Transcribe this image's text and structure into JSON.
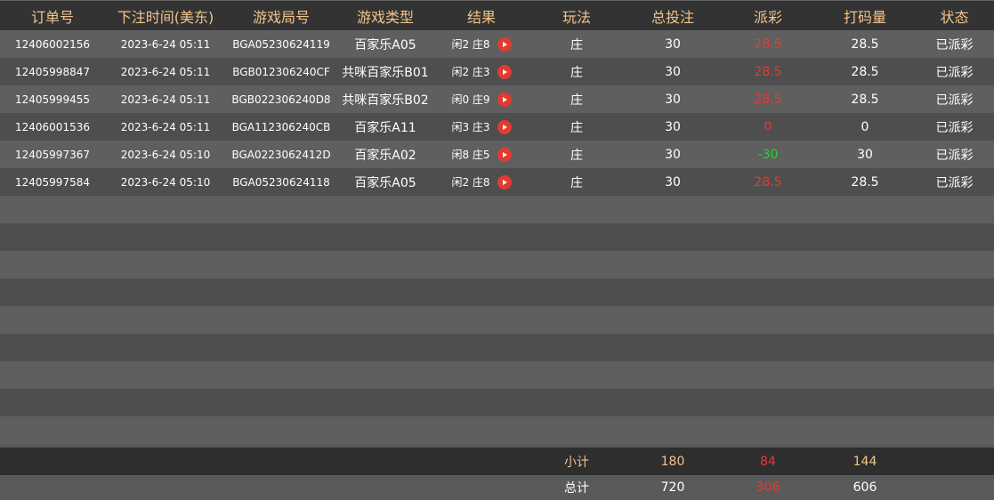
{
  "table": {
    "headers": [
      "订单号",
      "下注时间(美东)",
      "游戏局号",
      "游戏类型",
      "结果",
      "玩法",
      "总投注",
      "派彩",
      "打码量",
      "状态"
    ],
    "rows": [
      {
        "order_id": "12406002156",
        "bet_time": "2023-6-24 05:11",
        "round_id": "BGA05230624119",
        "game_type": "百家乐A05",
        "result": "闲2 庄8",
        "play": "庄",
        "bet": "30",
        "payout": "28.5",
        "payout_color": "#e43a33",
        "turnover": "28.5",
        "status": "已派彩"
      },
      {
        "order_id": "12405998847",
        "bet_time": "2023-6-24 05:11",
        "round_id": "BGB012306240CF",
        "game_type": "共咪百家乐B01",
        "result": "闲2 庄3",
        "play": "庄",
        "bet": "30",
        "payout": "28.5",
        "payout_color": "#e43a33",
        "turnover": "28.5",
        "status": "已派彩"
      },
      {
        "order_id": "12405999455",
        "bet_time": "2023-6-24 05:11",
        "round_id": "BGB022306240D8",
        "game_type": "共咪百家乐B02",
        "result": "闲0 庄9",
        "play": "庄",
        "bet": "30",
        "payout": "28.5",
        "payout_color": "#e43a33",
        "turnover": "28.5",
        "status": "已派彩"
      },
      {
        "order_id": "12406001536",
        "bet_time": "2023-6-24 05:11",
        "round_id": "BGA112306240CB",
        "game_type": "百家乐A11",
        "result": "闲3 庄3",
        "play": "庄",
        "bet": "30",
        "payout": "0",
        "payout_color": "#e43a33",
        "turnover": "0",
        "status": "已派彩"
      },
      {
        "order_id": "12405997367",
        "bet_time": "2023-6-24 05:10",
        "round_id": "BGA0223062412D",
        "game_type": "百家乐A02",
        "result": "闲8 庄5",
        "play": "庄",
        "bet": "30",
        "payout": "-30",
        "payout_color": "#27d22d",
        "turnover": "30",
        "status": "已派彩"
      },
      {
        "order_id": "12405997584",
        "bet_time": "2023-6-24 05:10",
        "round_id": "BGA05230624118",
        "game_type": "百家乐A05",
        "result": "闲2 庄8",
        "play": "庄",
        "bet": "30",
        "payout": "28.5",
        "payout_color": "#e43a33",
        "turnover": "28.5",
        "status": "已派彩"
      }
    ],
    "empty_row_count": 9
  },
  "subtotal": {
    "label": "小计",
    "bet": "180",
    "payout": "84",
    "turnover": "144"
  },
  "total": {
    "label": "总计",
    "bet": "720",
    "payout": "306",
    "turnover": "606"
  },
  "icons": {
    "result_play": "play-video-icon"
  },
  "colors": {
    "header_text": "#f2c48a",
    "loss_red": "#e43a33",
    "win_green": "#27d22d"
  }
}
